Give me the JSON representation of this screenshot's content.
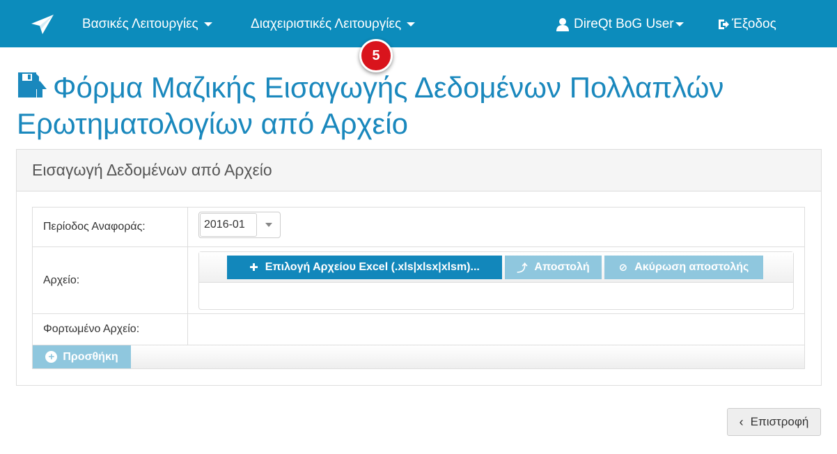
{
  "colors": {
    "navbar": "#0c8cbc",
    "title": "#1a88bd",
    "primary_button": "#1287bb",
    "disabled_button": "#8fc7de",
    "badge": "#d9141c"
  },
  "navbar": {
    "brand_icon": "paper-plane-icon",
    "basic_menu": "Βασικές Λειτουργίες",
    "admin_menu": "Διαχειριστικές Λειτουργίες",
    "user_menu": "DireQt BoG User",
    "logout": "Έξοδος"
  },
  "step_badge": "5",
  "page": {
    "title": "Φόρμα Μαζικής Εισαγωγής Δεδομένων Πολλαπλών Ερωτηματολογίων από Αρχείο",
    "title_icon": "save-upload-icon"
  },
  "panel": {
    "heading": "Εισαγωγή Δεδομένων από Αρχείο"
  },
  "form": {
    "period_label": "Περίοδος Αναφοράς:",
    "period_value": "2016-01",
    "file_label": "Αρχείο:",
    "choose_button": "Επιλογή Αρχείου Excel (.xls|xlsx|xlsm)...",
    "send_button": "Αποστολή",
    "cancel_button": "Ακύρωση αποστολής",
    "loaded_label": "Φορτωμένο Αρχείο:",
    "add_button": "Προσθήκη"
  },
  "back_button": "Επιστροφή"
}
